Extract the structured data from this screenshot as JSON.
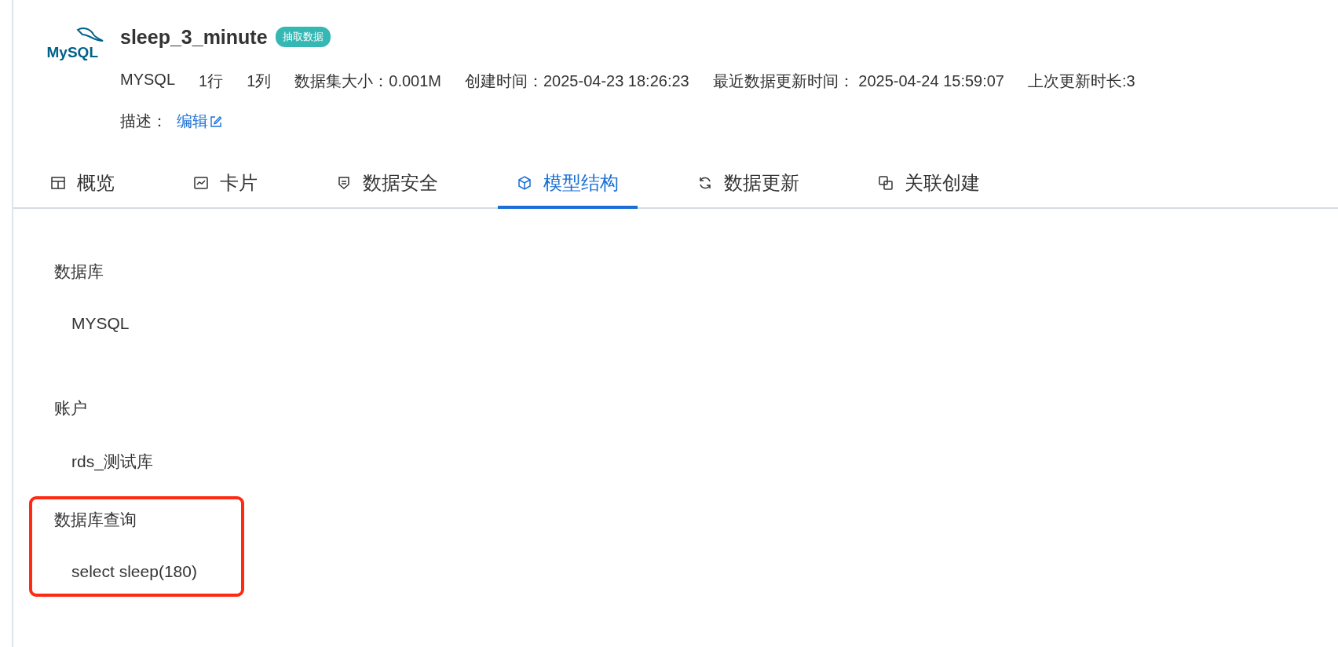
{
  "dataset": {
    "logo_text": "MySQL",
    "name": "sleep_3_minute",
    "badge": "抽取数据",
    "meta": [
      "MYSQL",
      "1行",
      "1列",
      "数据集大小：0.001M",
      "创建时间：2025-04-23 18:26:23",
      "最近数据更新时间：  2025-04-24 15:59:07",
      "上次更新时长:3"
    ],
    "description_label": "描述：",
    "edit_link": "编辑"
  },
  "tabs": [
    {
      "label": "概览",
      "kind": "table",
      "selected": false
    },
    {
      "label": "卡片",
      "kind": "chart",
      "selected": false
    },
    {
      "label": "数据安全",
      "kind": "shield",
      "selected": false
    },
    {
      "label": "模型结构",
      "kind": "cube",
      "selected": true
    },
    {
      "label": "数据更新",
      "kind": "refresh",
      "selected": false
    },
    {
      "label": "关联创建",
      "kind": "link",
      "selected": false
    }
  ],
  "sections": [
    {
      "label": "数据库",
      "value": "MYSQL",
      "highlighted": false
    },
    {
      "label": "账户",
      "value": "rds_测试库",
      "highlighted": false
    },
    {
      "label": "数据库查询",
      "value": "select sleep(180)",
      "highlighted": true
    }
  ]
}
